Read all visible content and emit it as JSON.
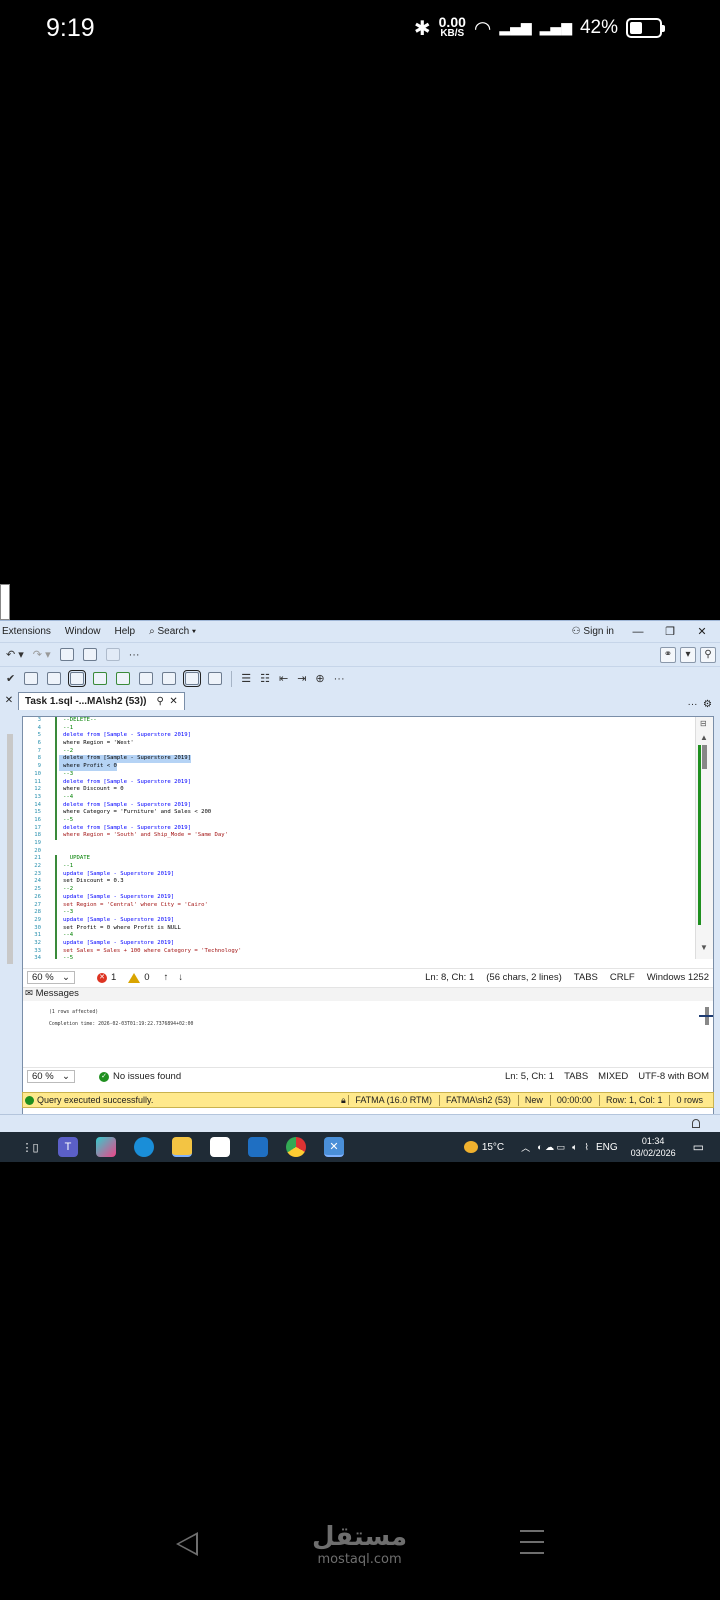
{
  "status_bar": {
    "time": "9:19",
    "speed_value": "0.00",
    "speed_unit": "KB/S",
    "battery": "42%",
    "battery_level": 0.42,
    "icons": [
      "bluetooth-icon",
      "wifi-icon",
      "signal-icon",
      "battery-icon"
    ]
  },
  "menu": {
    "items": [
      "Extensions",
      "Window",
      "Help",
      "Search"
    ],
    "sign_in": "Sign in"
  },
  "tab": {
    "title": "Task 1.sql -...MA\\sh2 (53))"
  },
  "code_lines": [
    {
      "n": "3",
      "t": "--DELETE--",
      "c": "comment",
      "m": true
    },
    {
      "n": "4",
      "t": "--1",
      "c": "comment",
      "m": true
    },
    {
      "n": "5",
      "t": "delete from [Sample - Superstore 2019]",
      "c": "kw",
      "m": true
    },
    {
      "n": "6",
      "t": "where Region = 'West'",
      "c": "",
      "m": true
    },
    {
      "n": "7",
      "t": "--2",
      "c": "comment",
      "m": true
    },
    {
      "n": "8",
      "t": "delete from [Sample - Superstore 2019]",
      "c": "sel",
      "m": true
    },
    {
      "n": "9",
      "t": "where Profit < 0",
      "c": "sel",
      "m": true
    },
    {
      "n": "10",
      "t": "--3",
      "c": "comment",
      "m": true
    },
    {
      "n": "11",
      "t": "delete from [Sample - Superstore 2019]",
      "c": "kw",
      "m": true
    },
    {
      "n": "12",
      "t": "where Discount = 0",
      "c": "",
      "m": true
    },
    {
      "n": "13",
      "t": "--4",
      "c": "comment",
      "m": true
    },
    {
      "n": "14",
      "t": "delete from [Sample - Superstore 2019]",
      "c": "kw",
      "m": true
    },
    {
      "n": "15",
      "t": "where Category = 'Furniture' and Sales < 200",
      "c": "",
      "m": true
    },
    {
      "n": "16",
      "t": "--5",
      "c": "comment",
      "m": true
    },
    {
      "n": "17",
      "t": "delete from [Sample - Superstore 2019]",
      "c": "kw",
      "m": true
    },
    {
      "n": "18",
      "t": "where Region = 'South' and Ship_Mode = 'Same Day'",
      "c": "str",
      "m": true
    },
    {
      "n": "19",
      "t": "",
      "c": "",
      "m": false
    },
    {
      "n": "20",
      "t": "",
      "c": "",
      "m": false
    },
    {
      "n": "21",
      "t": "  UPDATE",
      "c": "comment",
      "m": true
    },
    {
      "n": "22",
      "t": "--1",
      "c": "comment",
      "m": true
    },
    {
      "n": "23",
      "t": "update [Sample - Superstore 2019]",
      "c": "kw",
      "m": true
    },
    {
      "n": "24",
      "t": "set Discount = 0.3",
      "c": "",
      "m": true
    },
    {
      "n": "25",
      "t": "--2",
      "c": "comment",
      "m": true
    },
    {
      "n": "26",
      "t": "update [Sample - Superstore 2019]",
      "c": "kw",
      "m": true
    },
    {
      "n": "27",
      "t": "set Region = 'Central' where City = 'Cairo'",
      "c": "str",
      "m": true
    },
    {
      "n": "28",
      "t": "--3",
      "c": "comment",
      "m": true
    },
    {
      "n": "29",
      "t": "update [Sample - Superstore 2019]",
      "c": "kw",
      "m": true
    },
    {
      "n": "30",
      "t": "set Profit = 0 where Profit is NULL",
      "c": "",
      "m": true
    },
    {
      "n": "31",
      "t": "--4",
      "c": "comment",
      "m": true
    },
    {
      "n": "32",
      "t": "update [Sample - Superstore 2019]",
      "c": "kw",
      "m": true
    },
    {
      "n": "33",
      "t": "set Sales = Sales + 100 where Category = 'Technology'",
      "c": "str",
      "m": true
    },
    {
      "n": "34",
      "t": "--5",
      "c": "comment",
      "m": true
    }
  ],
  "editor_status": {
    "zoom": "60 %",
    "errors": "1",
    "warnings": "0",
    "position": "Ln: 8, Ch: 1",
    "selection": "(56 chars, 2 lines)",
    "indent": "TABS",
    "line_ending": "CRLF",
    "encoding": "Windows 1252"
  },
  "messages": {
    "tab_label": "Messages",
    "line1": "(1 rows affected)",
    "line2": "Completion time: 2026-02-03T01:19:22.7376894+02:00"
  },
  "results_status": {
    "zoom": "60 %",
    "issues": "No issues found",
    "position": "Ln: 5, Ch: 1",
    "indent": "TABS",
    "mixed": "MIXED",
    "encoding": "UTF-8 with BOM"
  },
  "query_bar": {
    "message": "Query executed successfully.",
    "server": "FATMA (16.0 RTM)",
    "user": "FATMA\\sh2 (53)",
    "db": "New",
    "elapsed": "00:00:00",
    "cursor": "Row: 1, Col: 1",
    "rows": "0 rows"
  },
  "taskbar": {
    "temperature": "15°C",
    "language": "ENG",
    "time": "01:34",
    "date": "03/02/2026",
    "weather_badge": "5"
  },
  "nav": {
    "watermark_ar": "مستقل",
    "watermark_en": "mostaql.com"
  }
}
